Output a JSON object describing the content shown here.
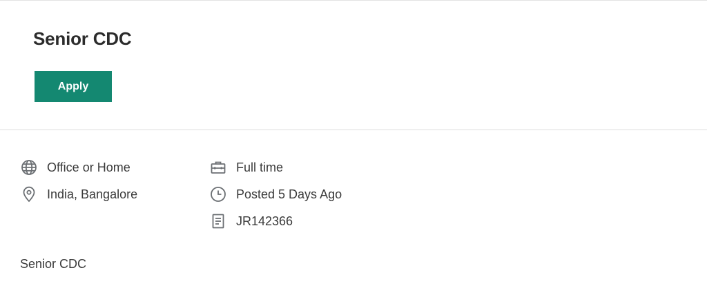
{
  "job": {
    "title": "Senior CDC",
    "apply_label": "Apply",
    "description": "Senior CDC"
  },
  "details": {
    "work_mode": {
      "icon": "globe-icon",
      "text": "Office or Home"
    },
    "location": {
      "icon": "location-pin-icon",
      "text": "India, Bangalore"
    },
    "employment_type": {
      "icon": "briefcase-icon",
      "text": "Full time"
    },
    "posted": {
      "icon": "clock-icon",
      "text": "Posted 5 Days Ago"
    },
    "requisition_id": {
      "icon": "document-icon",
      "text": "JR142366"
    }
  },
  "colors": {
    "accent": "#148871",
    "text": "#333333",
    "icon": "#6b6f73",
    "divider": "#dcdcdc"
  }
}
